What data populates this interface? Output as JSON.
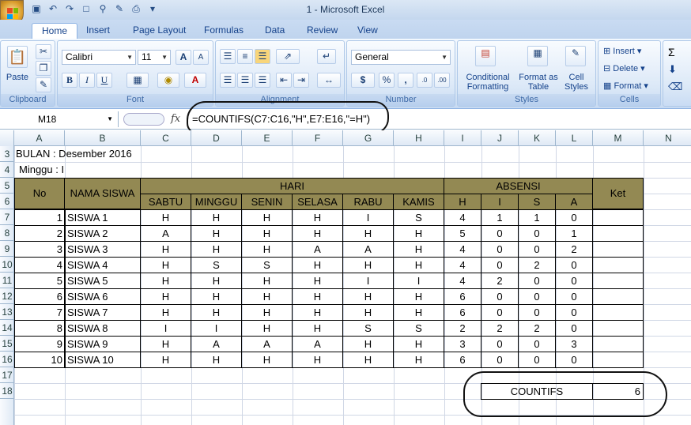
{
  "window": {
    "title": "1 - Microsoft Excel"
  },
  "tabs": [
    "Home",
    "Insert",
    "Page Layout",
    "Formulas",
    "Data",
    "Review",
    "View"
  ],
  "ribbon": {
    "clipboard": {
      "label": "Clipboard",
      "paste": "Paste"
    },
    "font": {
      "label": "Font",
      "name": "Calibri",
      "size": "11",
      "bold": "B",
      "italic": "I",
      "underline": "U",
      "grow": "A",
      "shrink": "A"
    },
    "alignment": {
      "label": "Alignment"
    },
    "number": {
      "label": "Number",
      "format": "General",
      "currency": "$",
      "percent": "%",
      "comma": ","
    },
    "styles": {
      "label": "Styles",
      "conditional": "Conditional Formatting",
      "format_table": "Format as Table",
      "cell_styles": "Cell Styles"
    },
    "cells": {
      "label": "Cells",
      "insert": "Insert",
      "delete": "Delete",
      "format": "Format"
    },
    "editing": {
      "sigma": "Σ"
    }
  },
  "formula_bar": {
    "name_box": "M18",
    "fx": "fx",
    "formula": "=COUNTIFS(C7:C16,\"H\",E7:E16,\"=H\")"
  },
  "columns": [
    "A",
    "B",
    "C",
    "D",
    "E",
    "F",
    "G",
    "H",
    "I",
    "J",
    "K",
    "L",
    "M",
    "N"
  ],
  "rows": [
    "3",
    "4",
    "5",
    "6",
    "7",
    "8",
    "9",
    "10",
    "11",
    "12",
    "13",
    "14",
    "15",
    "16",
    "17",
    "18"
  ],
  "sheet": {
    "bulan": "BULAN : Desember 2016",
    "minggu": "Minggu : I",
    "headers": {
      "no": "No",
      "nama": "NAMA SISWA",
      "hari": "HARI",
      "absensi": "ABSENSI",
      "ket": "Ket"
    },
    "days": [
      "SABTU",
      "MINGGU",
      "SENIN",
      "SELASA",
      "RABU",
      "KAMIS"
    ],
    "absensi_cols": [
      "H",
      "I",
      "S",
      "A"
    ],
    "students": [
      {
        "no": "1",
        "nama": "SISWA 1",
        "days": [
          "H",
          "H",
          "H",
          "H",
          "I",
          "S"
        ],
        "abs": [
          "4",
          "1",
          "1",
          "0"
        ]
      },
      {
        "no": "2",
        "nama": "SISWA 2",
        "days": [
          "A",
          "H",
          "H",
          "H",
          "H",
          "H"
        ],
        "abs": [
          "5",
          "0",
          "0",
          "1"
        ]
      },
      {
        "no": "3",
        "nama": "SISWA 3",
        "days": [
          "H",
          "H",
          "H",
          "A",
          "A",
          "H"
        ],
        "abs": [
          "4",
          "0",
          "0",
          "2"
        ]
      },
      {
        "no": "4",
        "nama": "SISWA 4",
        "days": [
          "H",
          "S",
          "S",
          "H",
          "H",
          "H"
        ],
        "abs": [
          "4",
          "0",
          "2",
          "0"
        ]
      },
      {
        "no": "5",
        "nama": "SISWA 5",
        "days": [
          "H",
          "H",
          "H",
          "H",
          "I",
          "I"
        ],
        "abs": [
          "4",
          "2",
          "0",
          "0"
        ]
      },
      {
        "no": "6",
        "nama": "SISWA 6",
        "days": [
          "H",
          "H",
          "H",
          "H",
          "H",
          "H"
        ],
        "abs": [
          "6",
          "0",
          "0",
          "0"
        ]
      },
      {
        "no": "7",
        "nama": "SISWA 7",
        "days": [
          "H",
          "H",
          "H",
          "H",
          "H",
          "H"
        ],
        "abs": [
          "6",
          "0",
          "0",
          "0"
        ]
      },
      {
        "no": "8",
        "nama": "SISWA 8",
        "days": [
          "I",
          "I",
          "H",
          "H",
          "S",
          "S"
        ],
        "abs": [
          "2",
          "2",
          "2",
          "0"
        ]
      },
      {
        "no": "9",
        "nama": "SISWA 9",
        "days": [
          "H",
          "A",
          "A",
          "A",
          "H",
          "H"
        ],
        "abs": [
          "3",
          "0",
          "0",
          "3"
        ]
      },
      {
        "no": "10",
        "nama": "SISWA 10",
        "days": [
          "H",
          "H",
          "H",
          "H",
          "H",
          "H"
        ],
        "abs": [
          "6",
          "0",
          "0",
          "0"
        ]
      }
    ],
    "countifs_label": "COUNTIFS",
    "countifs_value": "6"
  },
  "colors": {
    "header_fill": "#938953",
    "grid": "#d0d7e5"
  }
}
